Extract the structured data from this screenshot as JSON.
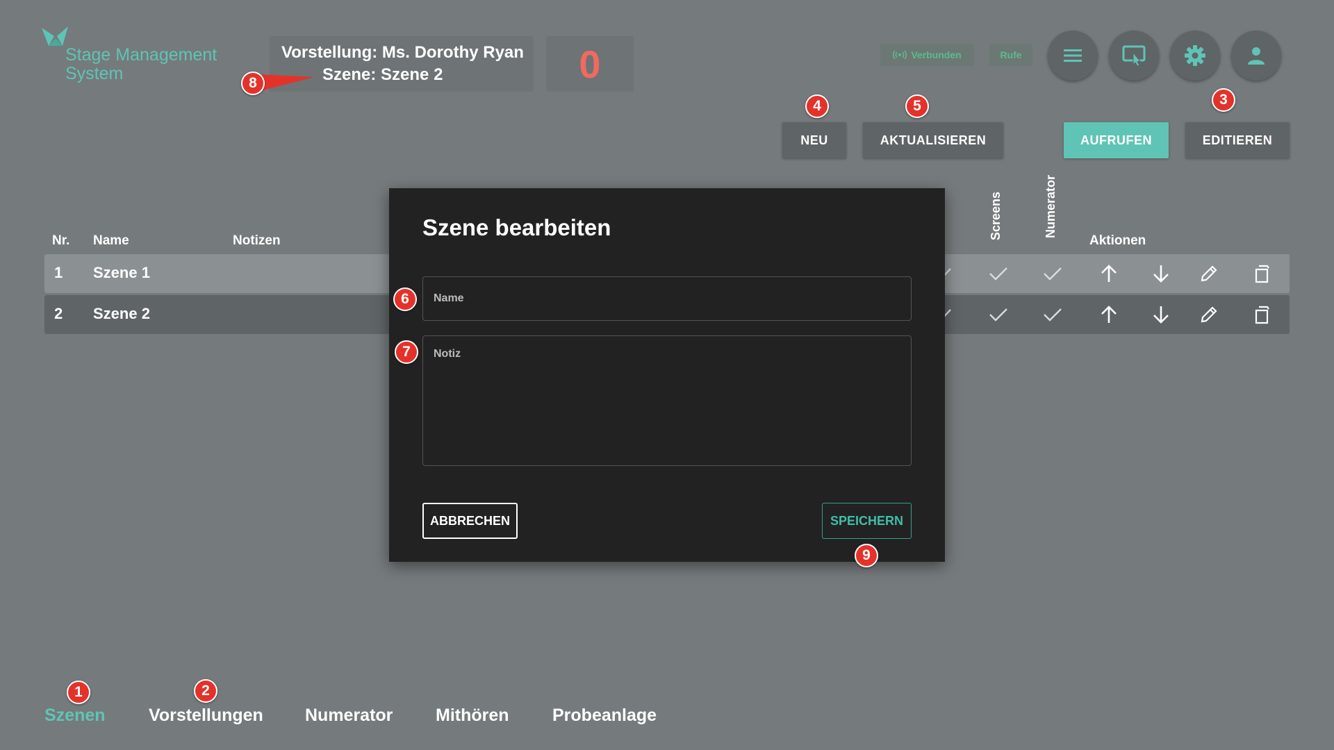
{
  "logo": {
    "text_line1": "Stage Management",
    "text_line2": "System",
    "color": "#5fc4b6"
  },
  "header": {
    "performance_label": "Vorstellung:",
    "performance_name": "Ms. Dorothy Ryan",
    "scene_label": "Szene:",
    "scene_name": "Szene 2",
    "counter": "0",
    "status_connected": "Verbunden",
    "status_calls": "Rufe",
    "icons": [
      "menu-icon",
      "screen-touch-icon",
      "gear-icon",
      "user-icon"
    ]
  },
  "toolbar": {
    "new_label": "NEU",
    "refresh_label": "AKTUALISIEREN",
    "call_label": "AUFRUFEN",
    "edit_label": "EDITIEREN",
    "accent": "#5fc4b6"
  },
  "table": {
    "col_nr": "Nr.",
    "col_name": "Name",
    "col_notes": "Notizen",
    "col_screens": "Screens",
    "col_numerator": "Numerator",
    "col_actions": "Aktionen",
    "rows": [
      {
        "nr": "1",
        "name": "Szene 1",
        "notes": ""
      },
      {
        "nr": "2",
        "name": "Szene 2",
        "notes": ""
      }
    ]
  },
  "modal": {
    "title": "Szene bearbeiten",
    "name_label": "Name",
    "note_label": "Notiz",
    "cancel_label": "ABBRECHEN",
    "save_label": "SPEICHERN"
  },
  "nav": {
    "items": [
      "Szenen",
      "Vorstellungen",
      "Numerator",
      "Mithören",
      "Probeanlage"
    ],
    "active": "Szenen"
  },
  "markers": [
    "1",
    "2",
    "3",
    "4",
    "5",
    "6",
    "7",
    "8",
    "9"
  ]
}
